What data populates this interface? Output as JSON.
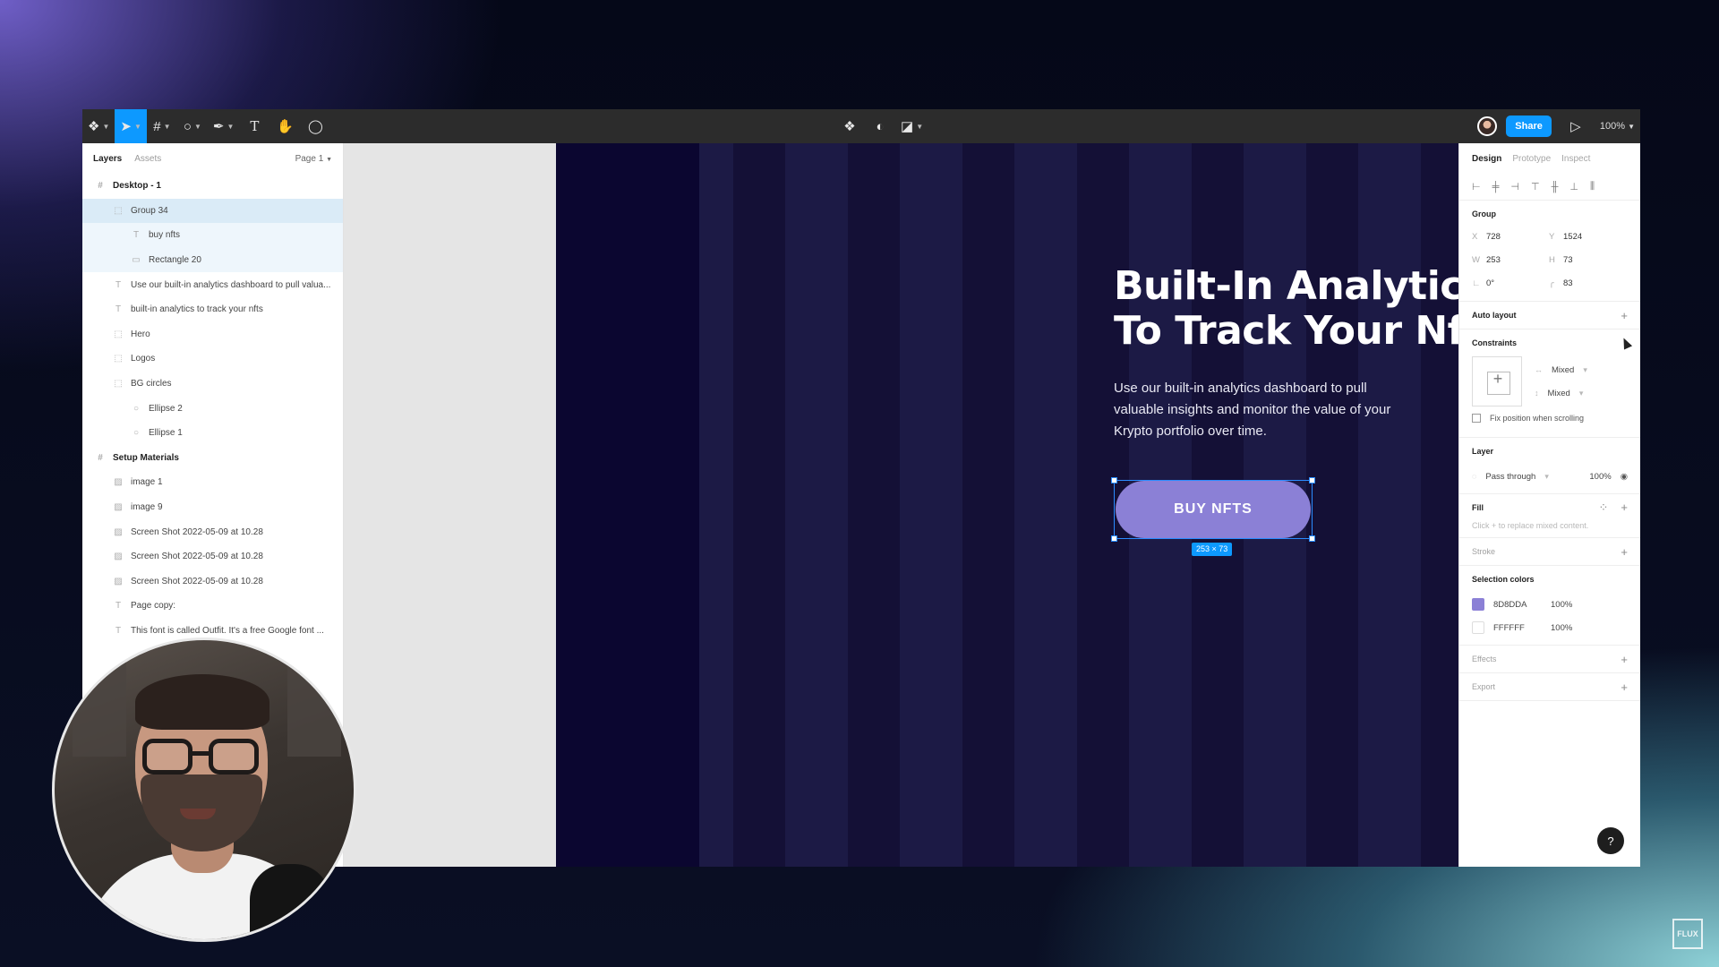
{
  "toolbar": {
    "share_label": "Share",
    "zoom": "100%"
  },
  "layers_panel": {
    "tab_layers": "Layers",
    "tab_assets": "Assets",
    "page": "Page 1",
    "items": [
      {
        "label": "Desktop - 1",
        "type": "frame",
        "level": 1,
        "bold": true
      },
      {
        "label": "Group 34",
        "type": "group",
        "level": 2,
        "selected": true
      },
      {
        "label": "buy nfts",
        "type": "text",
        "level": 3,
        "sub": true
      },
      {
        "label": "Rectangle 20",
        "type": "rect",
        "level": 3,
        "sub": true
      },
      {
        "label": "Use our built-in analytics dashboard to pull valua...",
        "type": "text",
        "level": 2
      },
      {
        "label": "built-in analytics to track your nfts",
        "type": "text",
        "level": 2
      },
      {
        "label": "Hero",
        "type": "group",
        "level": 2
      },
      {
        "label": "Logos",
        "type": "group",
        "level": 2
      },
      {
        "label": "BG circles",
        "type": "group",
        "level": 2
      },
      {
        "label": "Ellipse 2",
        "type": "ellipse",
        "level": 3
      },
      {
        "label": "Ellipse 1",
        "type": "ellipse",
        "level": 3
      },
      {
        "label": "Setup Materials",
        "type": "frame",
        "level": 1,
        "bold": true
      },
      {
        "label": "image 1",
        "type": "image",
        "level": 2
      },
      {
        "label": "image 9",
        "type": "image",
        "level": 2
      },
      {
        "label": "Screen Shot 2022-05-09 at 10.28",
        "type": "image",
        "level": 2
      },
      {
        "label": "Screen Shot 2022-05-09 at 10.28",
        "type": "image",
        "level": 2
      },
      {
        "label": "Screen Shot 2022-05-09 at 10.28",
        "type": "image",
        "level": 2
      },
      {
        "label": "Page copy:",
        "type": "text",
        "level": 2
      },
      {
        "label": "This font is called Outfit. It's a free Google font ...",
        "type": "text",
        "level": 2
      }
    ]
  },
  "canvas": {
    "headline": "Built-In Analytics\nTo Track Your Nft",
    "body": "Use our built-in analytics dashboard to pull valuable insights and monitor the value of your Krypto portfolio over time.",
    "cta": "BUY NFTS",
    "dimensions": "253 × 73",
    "frame_color": "#1c1a45",
    "stripe_color": "#0b0630",
    "button_color": "#8b80d6"
  },
  "design_panel": {
    "tab_design": "Design",
    "tab_prototype": "Prototype",
    "tab_inspect": "Inspect",
    "group_title": "Group",
    "x": "728",
    "y": "1524",
    "w": "253",
    "h": "73",
    "rotation": "0°",
    "radius": "83",
    "auto_layout": "Auto layout",
    "constraints": "Constraints",
    "constraint_h": "Mixed",
    "constraint_v": "Mixed",
    "fix_position": "Fix position when scrolling",
    "layer": "Layer",
    "blend": "Pass through",
    "opacity": "100%",
    "fill": "Fill",
    "fill_hint": "Click + to replace mixed content.",
    "stroke": "Stroke",
    "selection_colors": "Selection colors",
    "colors": [
      {
        "hex": "8D8DDA",
        "opacity": "100%",
        "swatch": "#8b80d6"
      },
      {
        "hex": "FFFFFF",
        "opacity": "100%",
        "swatch": "#ffffff"
      }
    ],
    "effects": "Effects",
    "export": "Export"
  },
  "watermark": "FLUX"
}
